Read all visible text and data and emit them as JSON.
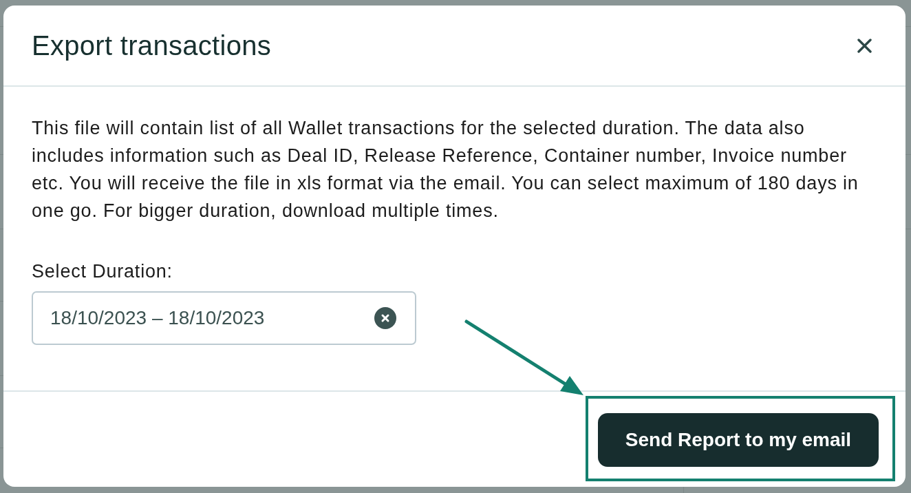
{
  "dialog": {
    "title": "Export transactions",
    "description": "This file will contain list of all Wallet transactions for the selected duration. The data also includes information such as Deal ID, Release Reference, Container number, Invoice number etc. You will receive the file in xls format via the email. You can select maximum of 180 days in one go. For bigger duration, download multiple times.",
    "duration": {
      "label": "Select Duration:",
      "value": "18/10/2023 – 18/10/2023"
    },
    "submit_button": "Send Report to my email"
  },
  "callouts": {
    "arrow": true,
    "highlight_frame": true
  }
}
